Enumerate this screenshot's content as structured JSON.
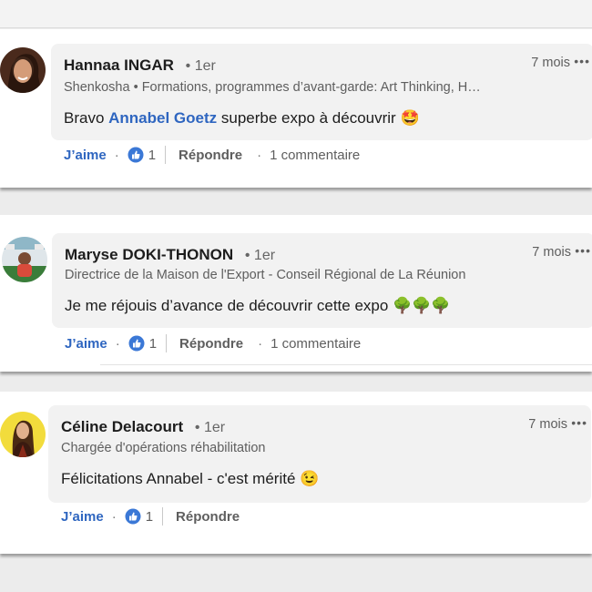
{
  "comments": [
    {
      "author": "Hannaa INGAR",
      "degree": "• 1er",
      "headline": "Shenkosha • Formations, programmes d’avant-garde: Art Thinking, H…",
      "time": "7 mois",
      "text_before": "Bravo ",
      "mention": "Annabel Goetz",
      "text_after": " superbe expo à découvrir 🤩",
      "like_label": "J’aime",
      "like_count": "1",
      "reply_label": "Répondre",
      "reply_count": "1 commentaire"
    },
    {
      "author": "Maryse DOKI-THONON",
      "degree": "• 1er",
      "headline": "Directrice de la Maison de l'Export - Conseil Régional de La Réunion",
      "time": "7 mois",
      "text": "Je me réjouis d’avance de découvrir cette expo 🌳🌳🌳",
      "like_label": "J’aime",
      "like_count": "1",
      "reply_label": "Répondre",
      "reply_count": "1 commentaire"
    },
    {
      "author": "Céline Delacourt",
      "degree": "• 1er",
      "headline": "Chargée d'opérations réhabilitation",
      "time": "7 mois",
      "text": "Félicitations Annabel - c'est mérité 😉",
      "like_label": "J’aime",
      "like_count": "1",
      "reply_label": "Répondre"
    }
  ],
  "more_glyph": "•••",
  "separator_glyph": "·",
  "colors": {
    "link": "#2f66c0",
    "bubble": "#f2f2f2",
    "text": "#1d1d1d",
    "muted": "#5e5e5e"
  }
}
